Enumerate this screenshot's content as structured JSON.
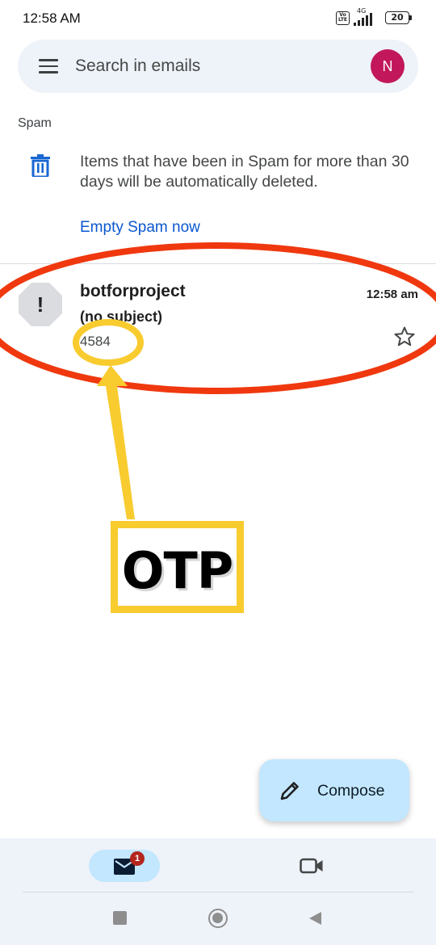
{
  "status_bar": {
    "time": "12:58 AM",
    "volte": "Vo LTE",
    "network": "4G",
    "battery": "20"
  },
  "search": {
    "placeholder": "Search in emails",
    "avatar_letter": "N",
    "avatar_color": "#c2185b"
  },
  "folder": {
    "label": "Spam",
    "info_text": "Items that have been in Spam for more than 30 days will be automatically deleted.",
    "empty_action": "Empty Spam now"
  },
  "emails": [
    {
      "avatar_icon": "exclamation-octagon-icon",
      "avatar_mark": "!",
      "sender": "botforproject",
      "time": "12:58 am",
      "subject": "(no subject)",
      "snippet": "4584",
      "starred": false
    }
  ],
  "annotation": {
    "label": "OTP",
    "ellipse_color": "#f0380f",
    "highlight_color": "#f8cb2f"
  },
  "compose": {
    "label": "Compose"
  },
  "bottom_nav": {
    "mail_badge": "1",
    "items": [
      "mail-icon",
      "video-camera-icon"
    ]
  },
  "colors": {
    "accent": "#0b57d0",
    "surface": "#eef2f9",
    "fab": "#c2e7ff"
  }
}
